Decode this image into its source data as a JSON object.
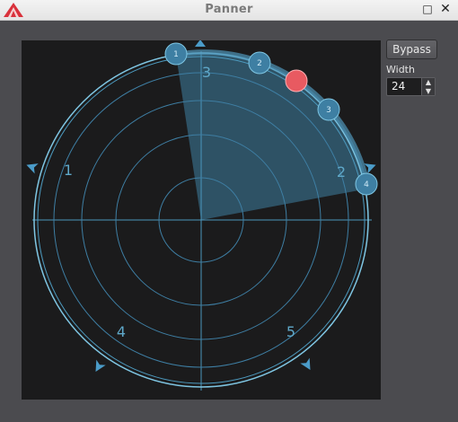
{
  "window": {
    "title": "Panner",
    "maximize_glyph": "□",
    "close_glyph": "✕"
  },
  "controls": {
    "bypass_label": "Bypass",
    "width_label": "Width",
    "width_value": "24",
    "spin_up_glyph": "▲",
    "spin_down_glyph": "▼"
  },
  "panner": {
    "zone_labels": [
      "1",
      "2",
      "3",
      "4",
      "5"
    ],
    "source_labels": [
      "1",
      "2",
      "3",
      "4"
    ]
  },
  "colors": {
    "accent": "#5fb3d4",
    "source_fill": "#3e7fa3",
    "selected_handle": "#e85a61",
    "canvas_bg": "#1b1b1c",
    "app_icon": "#d9313b"
  },
  "icons": {
    "app": "app-logo-icon",
    "speaker": "speaker-marker-icon",
    "maximize": "maximize-icon",
    "close": "close-icon"
  }
}
